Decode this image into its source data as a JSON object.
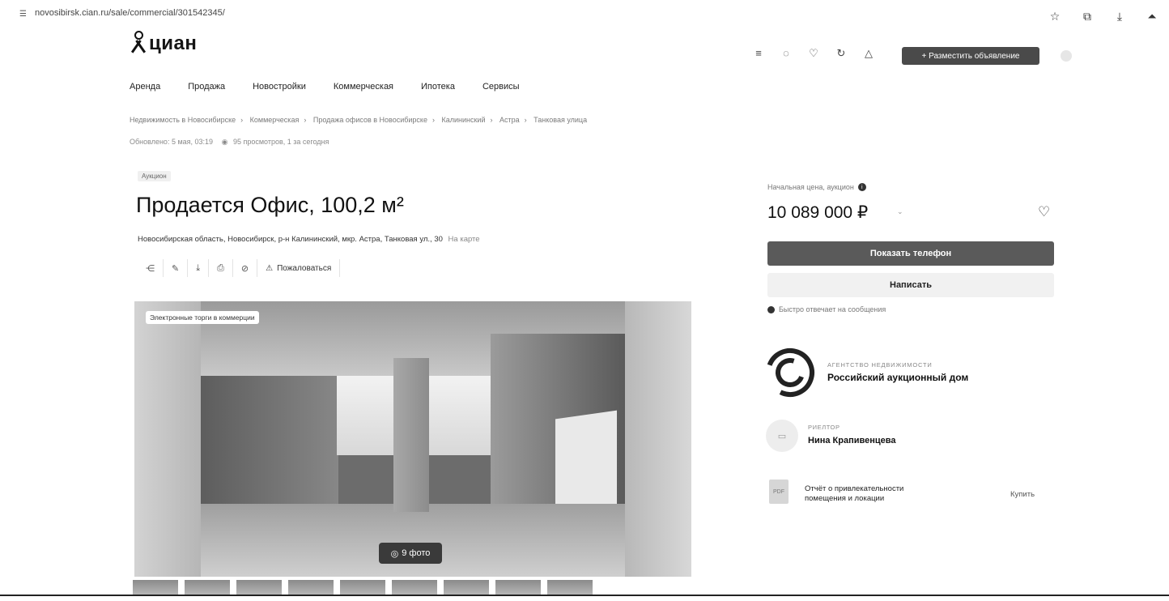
{
  "browser": {
    "url": "novosibirsk.cian.ru/sale/commercial/301542345/",
    "site_icon": "tune-icon",
    "actions": [
      {
        "icon": "star-icon",
        "glyph": "☆"
      },
      {
        "icon": "extensions-icon",
        "glyph": "⧉"
      },
      {
        "icon": "download-icon",
        "glyph": "⤓"
      },
      {
        "icon": "profile-icon",
        "glyph": "⏶"
      }
    ]
  },
  "header": {
    "logo_text": "циан",
    "icons": [
      {
        "name": "compare-icon",
        "glyph": "≡"
      },
      {
        "name": "chat-icon",
        "glyph": "◌"
      },
      {
        "name": "favorites-icon",
        "glyph": "♡"
      },
      {
        "name": "saved-search-icon",
        "glyph": "↻"
      },
      {
        "name": "notifications-icon",
        "glyph": "△"
      }
    ],
    "post_ad_label": "+ Разместить объявление"
  },
  "nav": {
    "items": [
      "Аренда",
      "Продажа",
      "Новостройки",
      "Коммерческая",
      "Ипотека",
      "Сервисы"
    ]
  },
  "breadcrumbs": [
    "Недвижимость в Новосибирске",
    "Коммерческая",
    "Продажа офисов в Новосибирске",
    "Калининский",
    "Астра",
    "Танковая улица"
  ],
  "meta": {
    "updated": "Обновлено: 5 мая, 03:19",
    "views": "95 просмотров, 1 за сегодня"
  },
  "listing": {
    "tag": "Аукцион",
    "title": "Продается Офис, 100,2 м²",
    "address": "Новосибирская область, Новосибирск, р-н Калининский, мкр. Астра, Танковая ул., 30",
    "map_link": "На карте",
    "tools": [
      {
        "name": "share-icon",
        "glyph": "⋲"
      },
      {
        "name": "edit-icon",
        "glyph": "✎"
      },
      {
        "name": "download-icon",
        "glyph": "⤓"
      },
      {
        "name": "print-icon",
        "glyph": "⎙"
      },
      {
        "name": "hide-icon",
        "glyph": "⊘"
      }
    ],
    "report_label": "Пожаловаться"
  },
  "gallery": {
    "label": "Электронные торги в коммерции",
    "photo_count": "9 фото",
    "thumb_count": 9
  },
  "sidebar": {
    "price_label": "Начальная цена, аукцион",
    "price": "10 089 000 ₽",
    "phone_button": "Показать телефон",
    "message_button": "Написать",
    "reply_note": "Быстро отвечает на сообщения",
    "agency": {
      "subtitle": "АГЕНТСТВО НЕДВИЖИМОСТИ",
      "name": "Российский аукционный дом"
    },
    "realtor": {
      "role": "РИЕЛТОР",
      "name": "Нина Крапивенцева"
    },
    "report": {
      "title": "Отчёт о привлекательности помещения и локации",
      "buy_label": "Купить",
      "pdf_badge": "PDF"
    }
  },
  "colors": {
    "button_dark": "#5a5a5a",
    "button_light": "#f1f1f1",
    "text_primary": "#111111",
    "text_muted": "#7a7a7a"
  }
}
